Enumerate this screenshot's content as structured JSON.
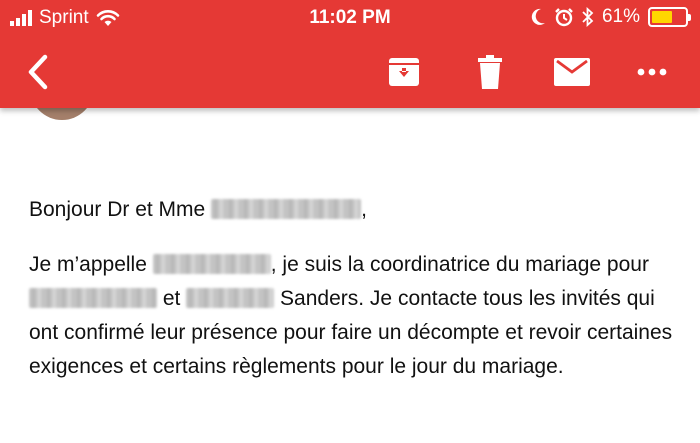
{
  "status_bar": {
    "carrier": "Sprint",
    "time": "11:02 PM",
    "battery_percent": "61%",
    "battery_level": 0.61,
    "icons": [
      "signal-icon",
      "wifi-icon",
      "moon-icon",
      "alarm-icon",
      "bluetooth-icon",
      "battery-icon"
    ]
  },
  "toolbar": {
    "icons": [
      "back-arrow-icon",
      "archive-icon",
      "trash-icon",
      "mail-icon",
      "more-icon"
    ]
  },
  "colors": {
    "header_bg": "#e53935",
    "battery_fill": "#ffd600"
  },
  "email": {
    "greeting_prefix": "Bonjour Dr et Mme",
    "greeting_suffix": ",",
    "p1_part1": "Je m’appelle",
    "p1_part2": ", je suis la coordinatrice du mariage pour",
    "p1_part3": "et",
    "p1_part4": "Sanders. Je contacte tous les invités qui ont confirmé leur présence pour faire un décompte et revoir certaines exigences et certains règlements pour le jour du mariage."
  }
}
